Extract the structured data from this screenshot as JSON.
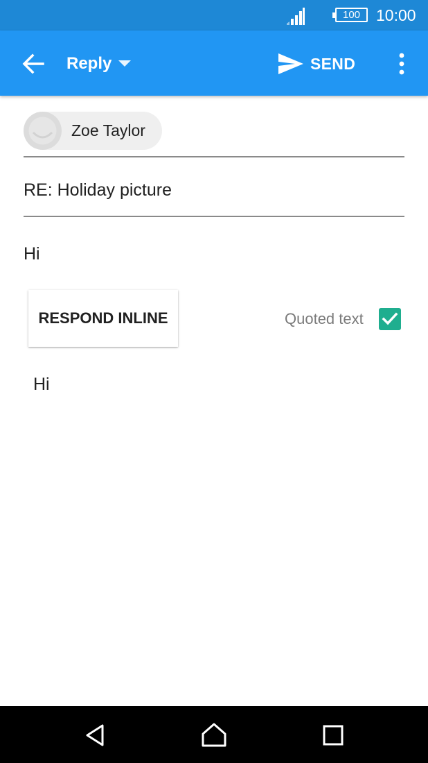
{
  "status_bar": {
    "battery": "100",
    "time": "10:00"
  },
  "app_bar": {
    "reply_label": "Reply",
    "send_label": "SEND"
  },
  "recipient": {
    "name": "Zoe Taylor"
  },
  "subject": "RE: Holiday picture",
  "body": "Hi",
  "respond_inline_label": "RESPOND INLINE",
  "quoted": {
    "label": "Quoted text",
    "checked": true,
    "text": "Hi"
  },
  "colors": {
    "app_bar": "#2196f3",
    "status_bar": "#1e88d6",
    "checkbox": "#1fae8f"
  },
  "icons": {
    "back": "arrow-left-icon",
    "dropdown": "triangle-down-icon",
    "send": "paper-plane-icon",
    "more": "more-vert-icon",
    "nav_back": "triangle-back-icon",
    "nav_home": "home-icon",
    "nav_recents": "square-icon"
  }
}
